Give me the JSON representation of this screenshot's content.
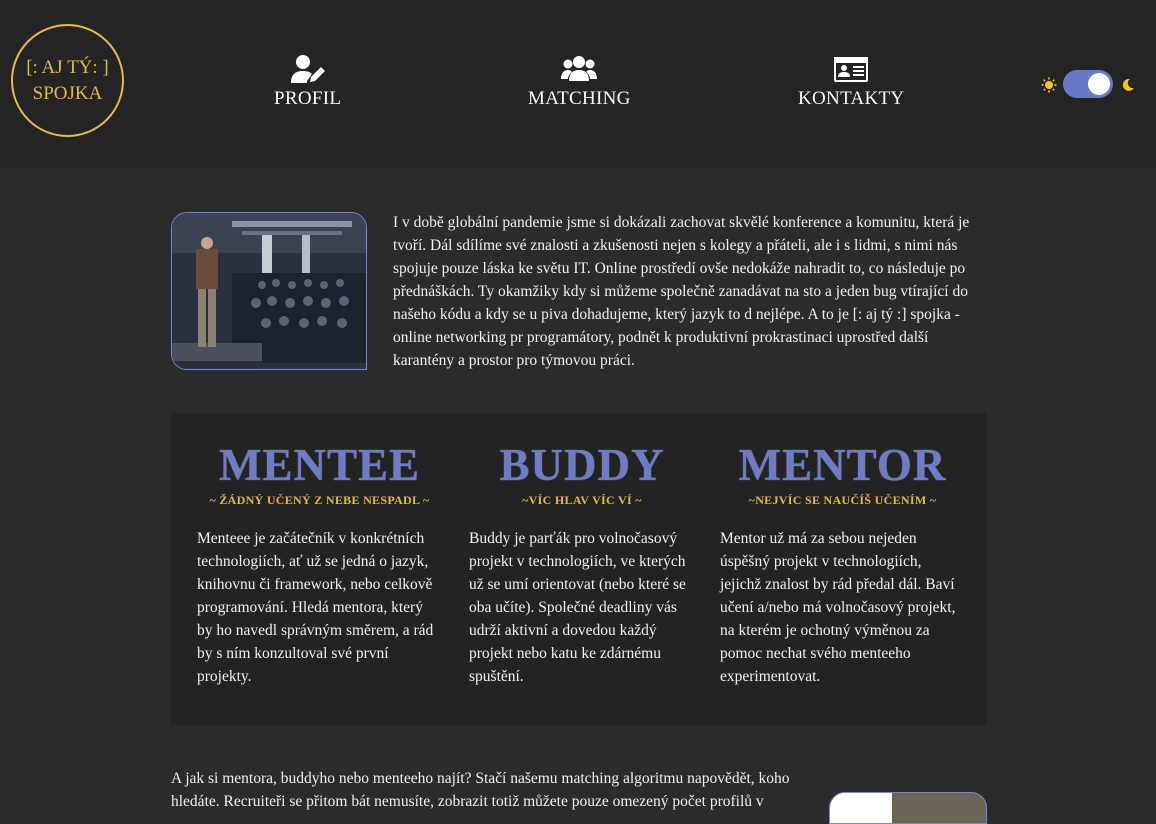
{
  "logo": {
    "line1": "[: AJ TÝ: ]",
    "line2": "SPOJKA"
  },
  "nav": {
    "profil": {
      "label": "PROFIL",
      "icon": "user-edit-icon"
    },
    "matching": {
      "label": "MATCHING",
      "icon": "users-icon"
    },
    "kontakty": {
      "label": "KONTAKTY",
      "icon": "id-card-icon"
    }
  },
  "theme_toggle": {
    "sun_icon": "sun-icon",
    "moon_icon": "moon-icon",
    "state": "dark",
    "accent": "#6878c8"
  },
  "intro": {
    "text": "I v době globální pandemie jsme si dokázali zachovat skvělé konference a komunitu, která je tvoří. Dál sdílíme své znalosti a zkušenosti nejen s kolegy a přáteli, ale i s lidmi, s nimi nás spojuje pouze láska ke světu IT. Online prostředí ovše nedokáže nahradit to, co následuje po přednáškách. Ty okamžiky kdy si můžeme společně zanadávat na sto a jeden bug vtírající do našeho kódu a kdy se u piva dohadujeme, který jazyk to d nejlépe. A to je [: aj tý :] spojka - online networking pr programátory, podnět k produktivní prokrastinaci uprostřed další karantény a prostor pro týmovou práci."
  },
  "roles": [
    {
      "title": "MENTEE",
      "motto": "~ ŽÁDNÝ UČENÝ Z NEBE NESPADL ~",
      "text": "Menteee je začátečník v konkrétních technologiích, ať už se jedná o jazyk, knihovnu či framework, nebo celkově programování. Hledá mentora, který by ho navedl správným směrem, a rád by s ním konzultoval své první projekty."
    },
    {
      "title": "BUDDY",
      "motto": "~VÍC HLAV VÍC VÍ ~",
      "text": "Buddy je parťák pro volnočasový projekt v technologiích, ve kterých už se umí orientovat (nebo které se oba učíte). Společné deadliny vás udrží aktivní a dovedou každý projekt nebo katu ke zdárnému spuštění."
    },
    {
      "title": "MENTOR",
      "motto": "~NEJVÍC SE NAUČÍŠ UČENÍM ~",
      "text": "Mentor už má za sebou nejeden úspěšný projekt v technologiích, jejichž znalost by rád předal dál. Baví učení a/nebo má volnočasový projekt, na kterém je ochotný výměnou za pomoc nechat svého menteeho experimentovat."
    }
  ],
  "outro": {
    "text": "A jak si mentora, buddyho nebo menteeho najít? Stačí našemu matching algoritmu napovědět, koho hledáte. Recruiteři se přitom bát nemusíte, zobrazit totiž můžete pouze omezený počet profilů v"
  },
  "colors": {
    "background": "#2b2b2b",
    "header": "#242424",
    "gold": "#e6b84d",
    "blue": "#6f7cc4"
  }
}
